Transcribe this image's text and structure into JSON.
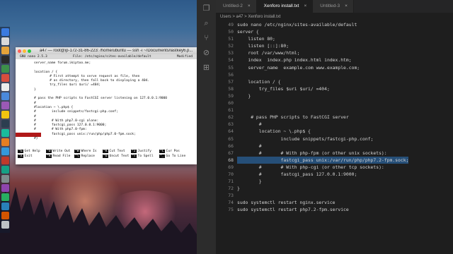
{
  "terminal": {
    "title": "a47 — root@ip-172-31-86-223: /home/ubuntu — ssh -i ~/Documents/lastkey6.p...",
    "nano_version": "GNU nano 2.5.3",
    "nano_file": "File: /etc/nginx/sites-available/default",
    "nano_status": "Modified",
    "lines": [
      "server_name forum.ikiptoo.me;",
      "",
      "location / {",
      "        # First attempt to serve request as file, then",
      "        # as directory, then fall back to displaying a 404.",
      "        try_files $uri $uri/ =404;",
      "}",
      "",
      "# pass the PHP scripts to FastCGI server listening on 127.0.0.1:9000",
      "#",
      "#location ~ \\.php$ {",
      "#        include snippets/fastcgi-php.conf;",
      "#",
      "#        # With php7.0-cgi alone:",
      "#        fastcgi_pass 127.0.0.1:9000;",
      "#        # With php7.0-fpm:",
      "         fastcgi_pass unix:/run/php/php7.0-fpm.sock;",
      "#}"
    ],
    "help_row1": [
      {
        "key": "^G",
        "label": "Get Help"
      },
      {
        "key": "^O",
        "label": "Write Out"
      },
      {
        "key": "^W",
        "label": "Where Is"
      },
      {
        "key": "^K",
        "label": "Cut Text"
      },
      {
        "key": "^J",
        "label": "Justify"
      },
      {
        "key": "^C",
        "label": "Cur Pos"
      }
    ],
    "help_row2": [
      {
        "key": "^X",
        "label": "Exit"
      },
      {
        "key": "^R",
        "label": "Read File"
      },
      {
        "key": "^\\",
        "label": "Replace"
      },
      {
        "key": "^U",
        "label": "Uncut Text"
      },
      {
        "key": "^T",
        "label": "To Spell"
      },
      {
        "key": "^_",
        "label": "Go To Line"
      }
    ]
  },
  "vscode": {
    "tabs": [
      {
        "label": "Untitled-2",
        "active": false
      },
      {
        "label": "Xenforo install.txt",
        "active": true
      },
      {
        "label": "Untitled-3",
        "active": false
      }
    ],
    "breadcrumb": "Users > a47 > Xenforo install.txt",
    "code_lines": [
      {
        "num": "49",
        "text": "sudo nano /etc/nginx/sites-available/default"
      },
      {
        "num": "50",
        "text": "server {"
      },
      {
        "num": "51",
        "text": "    listen 80;"
      },
      {
        "num": "52",
        "text": "    listen [::]:80;"
      },
      {
        "num": "53",
        "text": "    root /var/www/html;"
      },
      {
        "num": "54",
        "text": "    index  index.php index.html index.htm;"
      },
      {
        "num": "55",
        "text": "    server_name  example.com www.example.com;"
      },
      {
        "num": "56",
        "text": ""
      },
      {
        "num": "57",
        "text": "    location / {"
      },
      {
        "num": "58",
        "text": "        try_files $uri $uri/ =404;"
      },
      {
        "num": "59",
        "text": "    }"
      },
      {
        "num": "60",
        "text": ""
      },
      {
        "num": "61",
        "text": ""
      },
      {
        "num": "62",
        "text": "     # pass PHP scripts to FastCGI server"
      },
      {
        "num": "63",
        "text": "        #"
      },
      {
        "num": "64",
        "text": "        location ~ \\.php$ {"
      },
      {
        "num": "65",
        "text": "                include snippets/fastcgi-php.conf;"
      },
      {
        "num": "66",
        "text": "        #"
      },
      {
        "num": "67",
        "text": "        #       # With php-fpm (or other unix sockets):"
      },
      {
        "num": "68",
        "text": "                fastcgi_pass unix:/var/run/php/php7.2-fpm.sock;"
      },
      {
        "num": "69",
        "text": "        #       # With php-cgi (or other tcp sockets):"
      },
      {
        "num": "70",
        "text": "        #       fastcgi_pass 127.0.0.1:9000;"
      },
      {
        "num": "71",
        "text": "        }"
      },
      {
        "num": "72",
        "text": "}"
      },
      {
        "num": "73",
        "text": ""
      },
      {
        "num": "74",
        "text": "sudo systemctl restart nginx.service"
      },
      {
        "num": "75",
        "text": "sudo systemctl restart php7.2-fpm.service"
      }
    ],
    "current_line": "68"
  }
}
